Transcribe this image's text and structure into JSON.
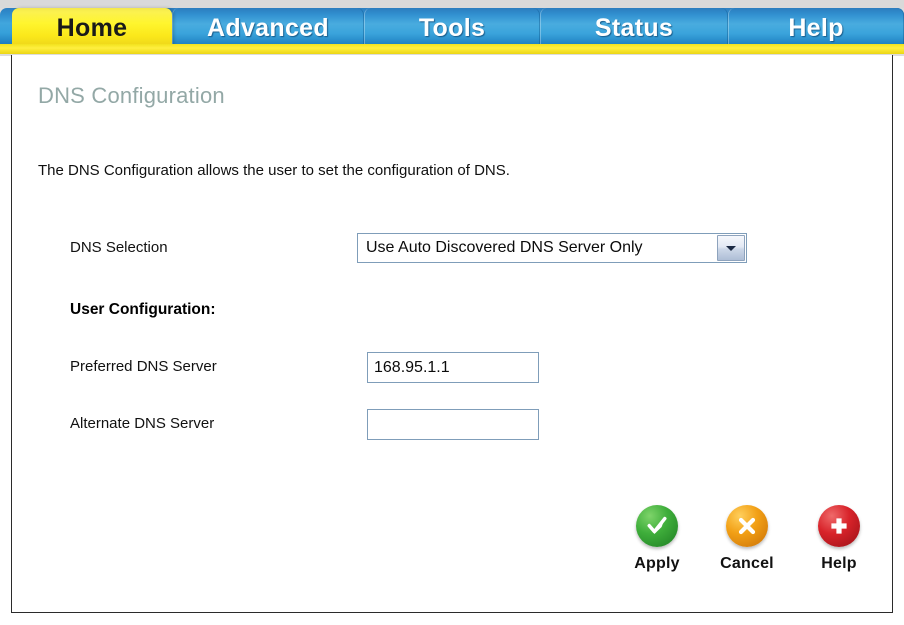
{
  "navbar": {
    "tabs": [
      {
        "label": "Home",
        "active": true
      },
      {
        "label": "Advanced",
        "active": false
      },
      {
        "label": "Tools",
        "active": false
      },
      {
        "label": "Status",
        "active": false
      },
      {
        "label": "Help",
        "active": false
      }
    ]
  },
  "page": {
    "title": "DNS Configuration",
    "description": "The DNS Configuration allows the user to set the configuration of DNS."
  },
  "form": {
    "dns_selection": {
      "label": "DNS Selection",
      "value": "Use Auto Discovered DNS Server Only",
      "icon": "chevron-down-icon"
    },
    "user_configuration_heading": "User Configuration:",
    "preferred_dns": {
      "label": "Preferred DNS Server",
      "value": "168.95.1.1",
      "placeholder": ""
    },
    "alternate_dns": {
      "label": "Alternate DNS Server",
      "value": "",
      "placeholder": ""
    }
  },
  "actions": {
    "apply": {
      "label": "Apply",
      "icon": "check-circle-icon",
      "color": "#3fae3b"
    },
    "cancel": {
      "label": "Cancel",
      "icon": "x-circle-icon",
      "color": "#f2a016"
    },
    "help": {
      "label": "Help",
      "icon": "plus-circle-icon",
      "color": "#d8232a"
    }
  },
  "theme": {
    "active_tab_bg": "#fff52e",
    "inactive_tab_bg": "#3aa3db",
    "title_color": "#93a8a6",
    "input_border": "#7f9db9"
  }
}
